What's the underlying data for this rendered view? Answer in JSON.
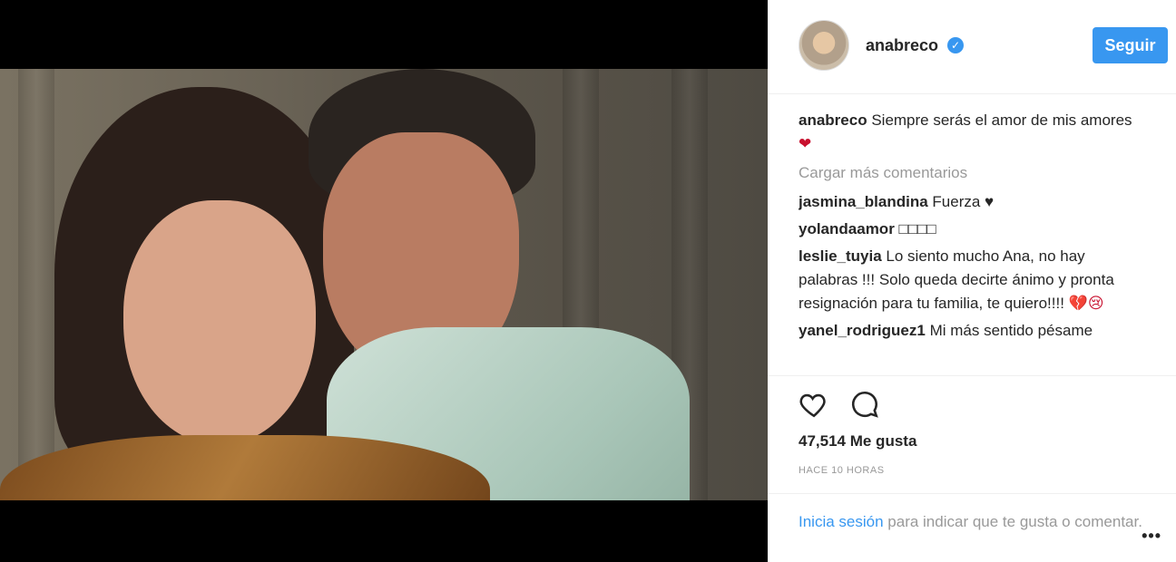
{
  "post": {
    "username": "anabreco",
    "follow_label": "Seguir",
    "caption": "Siempre serás el amor de mis amores",
    "load_more_label": "Cargar más comentarios",
    "comments": [
      {
        "user": "jasmina_blandina",
        "text": "Fuerza ♥"
      },
      {
        "user": "yolandaamor",
        "text": "□□□□"
      },
      {
        "user": "leslie_tuyia",
        "text": "Lo siento mucho Ana, no hay palabras !!! Solo queda decirte ánimo y pronta resignación para tu familia, te quiero!!!!"
      },
      {
        "user": "yanel_rodriguez1",
        "text": "Mi más sentido pésame"
      }
    ],
    "likes_label": "47,514 Me gusta",
    "timestamp": "HACE 10 HORAS",
    "login_link": "Inicia sesión",
    "login_text": " para indicar que te gusta o comentar."
  },
  "colors": {
    "accent": "#3897f0",
    "muted": "#999999"
  },
  "icons": [
    "verified-icon",
    "heart-icon",
    "comment-bubble-icon",
    "more-options-icon"
  ]
}
